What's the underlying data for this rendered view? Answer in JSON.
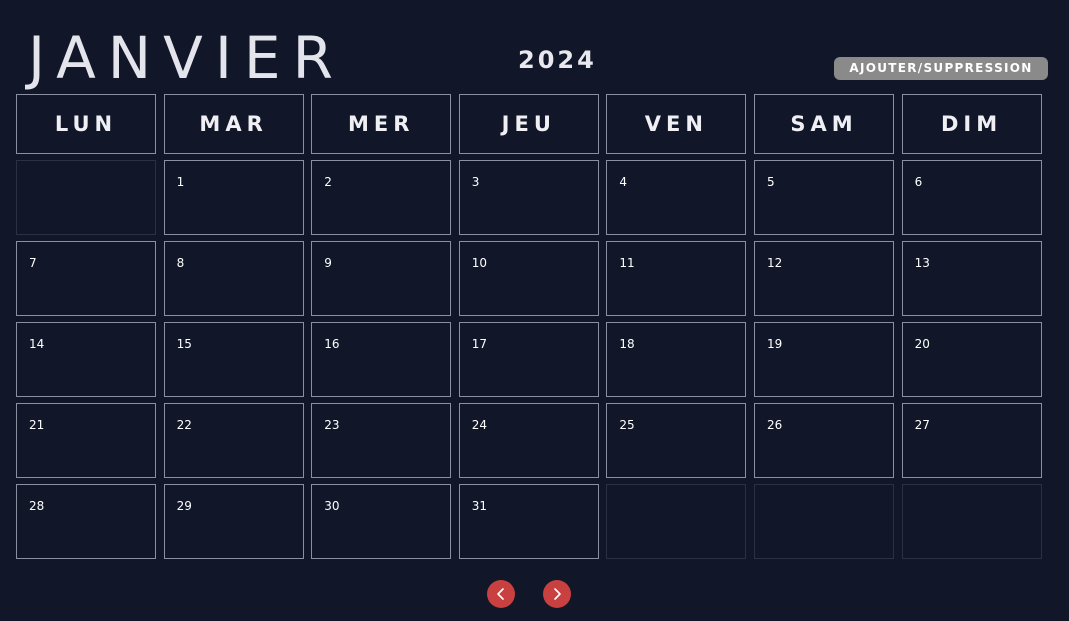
{
  "header": {
    "month": "JANVIER",
    "year": "2024",
    "add_remove_label": "AJOUTER/SUPPRESSION"
  },
  "weekdays": [
    "LUN",
    "MAR",
    "MER",
    "JEU",
    "VEN",
    "SAM",
    "DIM"
  ],
  "weeks": [
    [
      "",
      "1",
      "2",
      "3",
      "4",
      "5",
      "6"
    ],
    [
      "7",
      "8",
      "9",
      "10",
      "11",
      "12",
      "13"
    ],
    [
      "14",
      "15",
      "16",
      "17",
      "18",
      "19",
      "20"
    ],
    [
      "21",
      "22",
      "23",
      "24",
      "25",
      "26",
      "27"
    ],
    [
      "28",
      "29",
      "30",
      "31",
      "",
      "",
      ""
    ]
  ],
  "navigation": {
    "prev_icon": "chevron-left-icon",
    "next_icon": "chevron-right-icon"
  },
  "colors": {
    "background": "#111729",
    "cell_border": "#8b8fa0",
    "nav_button": "#c84040",
    "add_button": "#8a8a8a"
  }
}
